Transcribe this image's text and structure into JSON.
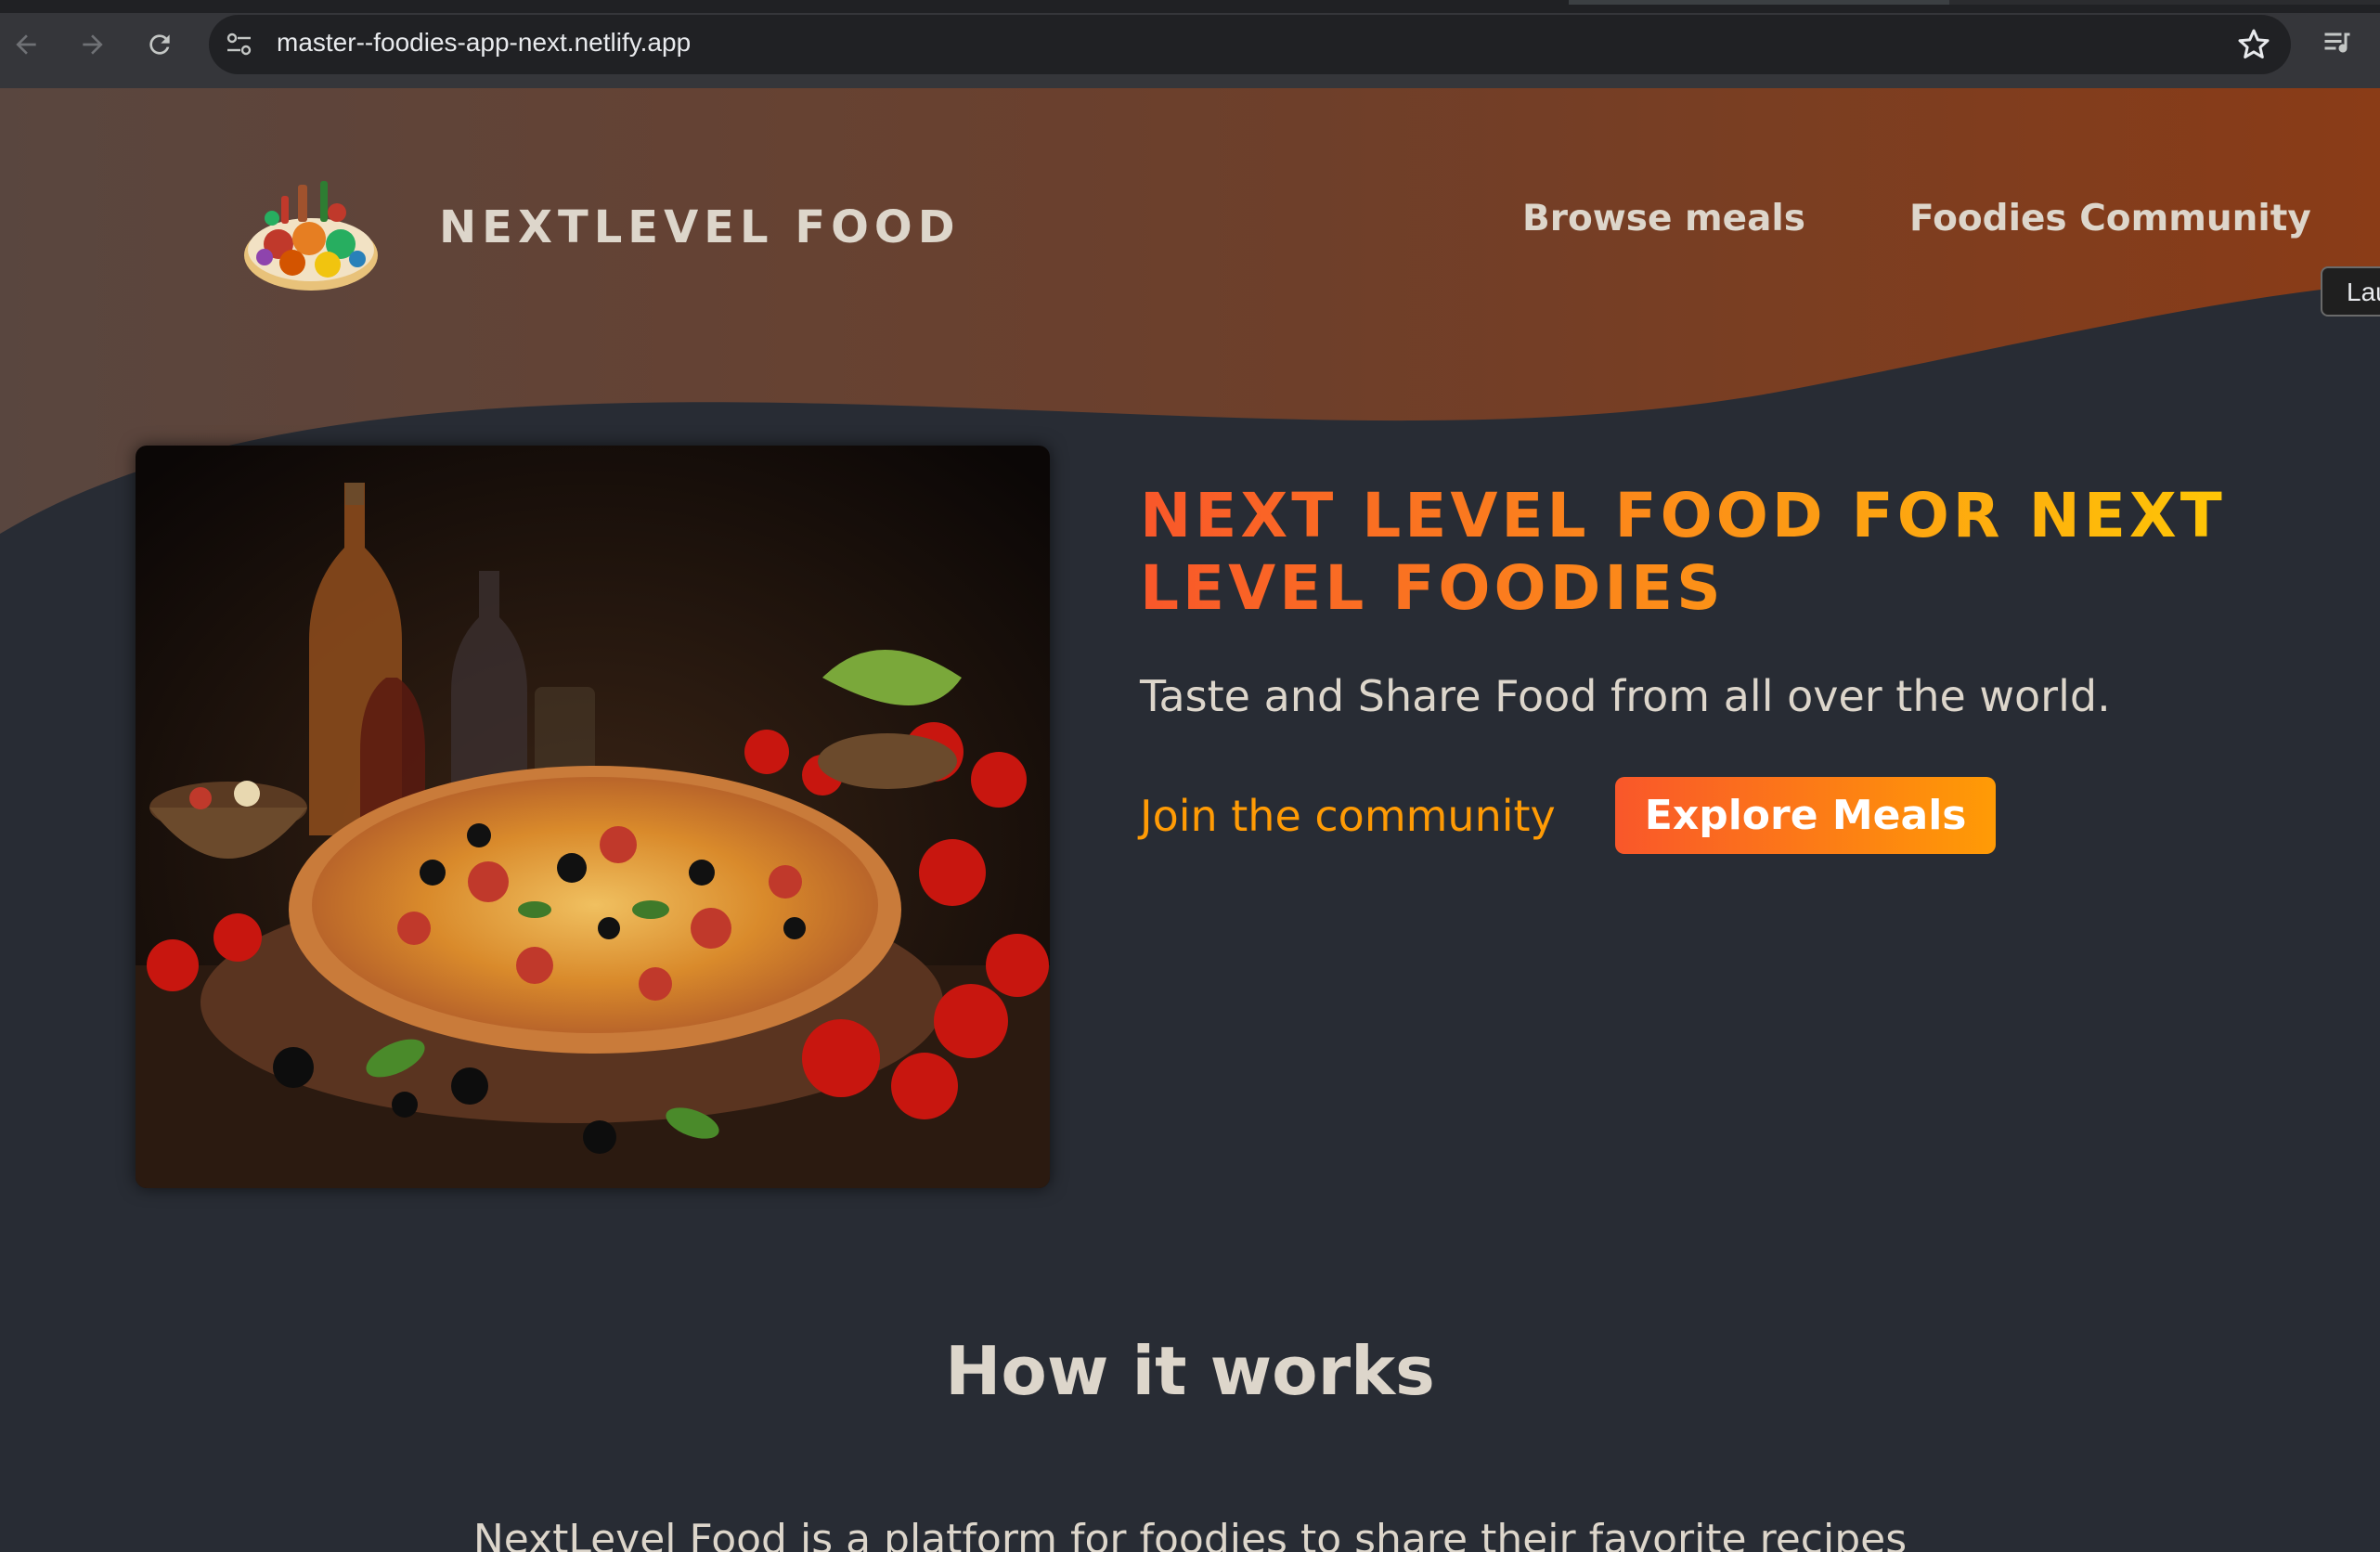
{
  "browser": {
    "url": "master--foodies-app-next.netlify.app",
    "tooltip": "Lau"
  },
  "header": {
    "logo_text": "NEXTLEVEL FOOD",
    "nav": [
      {
        "label": "Browse meals"
      },
      {
        "label": "Foodies Community"
      }
    ]
  },
  "hero": {
    "title": "NEXT LEVEL FOOD FOR NEXT LEVEL FOODIES",
    "subtitle": "Taste and Share Food from all over the world.",
    "join_link": "Join the community",
    "explore_button": "Explore Meals"
  },
  "how_it_works": {
    "title": "How it works",
    "body": "NextLevel Food is a platform for foodies to share their favorite recipes"
  },
  "colors": {
    "background": "#282c34",
    "header_gradient_start": "#59463f",
    "header_gradient_end": "#8a3c17",
    "accent_orange": "#f9572a",
    "accent_yellow": "#ffc905",
    "text": "#ddd6cb"
  },
  "icons": [
    "back-arrow-icon",
    "forward-arrow-icon",
    "reload-icon",
    "site-settings-icon",
    "bookmark-star-icon",
    "reading-list-icon"
  ]
}
